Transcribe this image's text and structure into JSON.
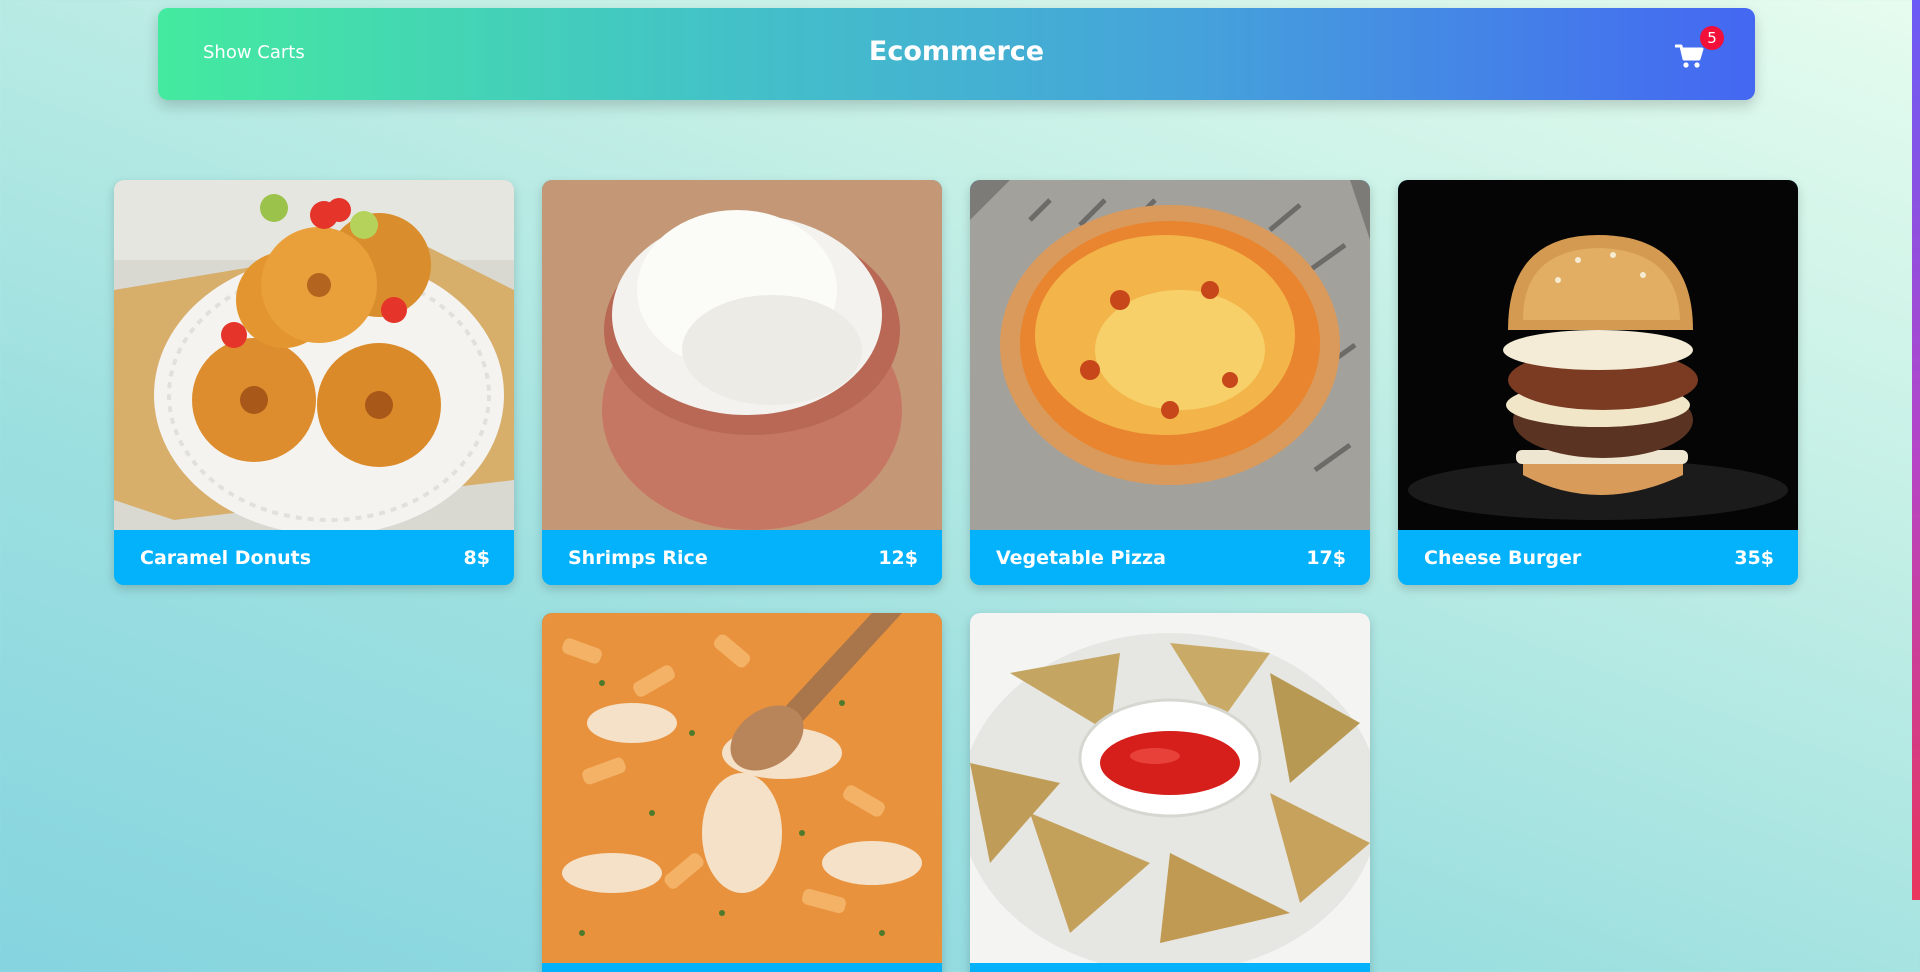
{
  "header": {
    "show_carts_label": "Show Carts",
    "title": "Ecommerce",
    "cart_count": "5",
    "cart_icon": "shopping-cart-icon"
  },
  "colors": {
    "price_bar": "#04b2fb",
    "badge": "#f2103a"
  },
  "products": [
    {
      "name": "Caramel Donuts",
      "price": "8$",
      "image": "donuts-image"
    },
    {
      "name": "Shrimps Rice",
      "price": "12$",
      "image": "rice-bowl-image"
    },
    {
      "name": "Vegetable Pizza",
      "price": "17$",
      "image": "pizza-image"
    },
    {
      "name": "Cheese Burger",
      "price": "35$",
      "image": "burger-image"
    },
    {
      "name": "",
      "price": "",
      "image": "pasta-image"
    },
    {
      "name": "",
      "price": "",
      "image": "samosa-image"
    }
  ]
}
